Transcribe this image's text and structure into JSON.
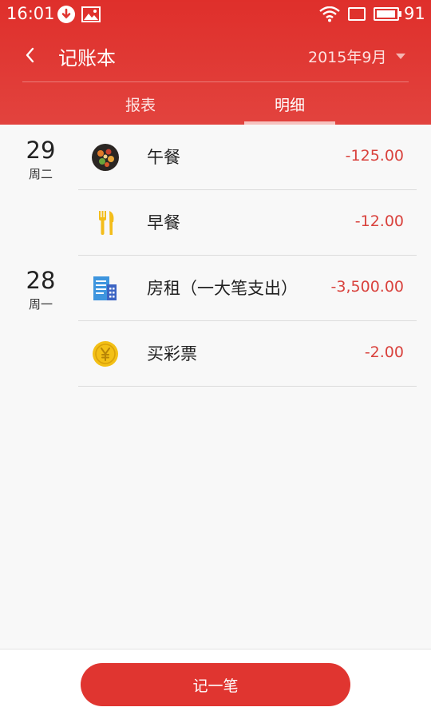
{
  "status_bar": {
    "time": "16:01",
    "battery_level": "91",
    "icons": [
      "download-icon",
      "image-icon",
      "wifi-icon",
      "tablet-icon",
      "battery-icon"
    ]
  },
  "header": {
    "back_icon": "chevron-left-icon",
    "title": "记账本",
    "month": "2015年9月",
    "month_caret_icon": "caret-down-icon"
  },
  "tabs": [
    {
      "label": "报表",
      "active": false
    },
    {
      "label": "明细",
      "active": true
    }
  ],
  "days": [
    {
      "day": "29",
      "weekday": "周二"
    },
    {
      "day": "28",
      "weekday": "周一"
    }
  ],
  "entries": [
    {
      "icon": "food-plate-icon",
      "label": "午餐",
      "amount": "-125.00"
    },
    {
      "icon": "fork-knife-icon",
      "label": "早餐",
      "amount": "-12.00"
    },
    {
      "icon": "building-icon",
      "label": "房租（一大笔支出）",
      "amount": "-3,500.00"
    },
    {
      "icon": "yen-coin-icon",
      "label": "买彩票",
      "amount": "-2.00"
    }
  ],
  "bottom": {
    "add_button_label": "记一笔"
  },
  "colors": {
    "accent": "#e03530",
    "amount": "#d9423d",
    "background": "#f8f8f8"
  }
}
